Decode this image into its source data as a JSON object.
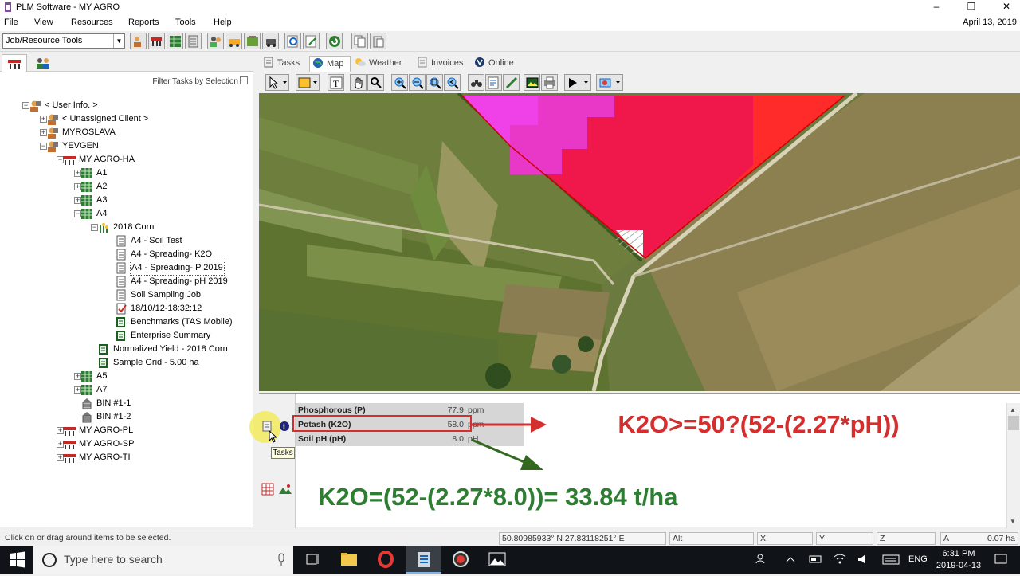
{
  "window": {
    "title": "PLM Software - MY AGRO",
    "controls": [
      "minimize",
      "restore",
      "close"
    ]
  },
  "menubar": {
    "items": [
      "File",
      "View",
      "Resources",
      "Reports",
      "Tools",
      "Help"
    ],
    "date": "April 13, 2019"
  },
  "toolbar": {
    "combo_value": "Job/Resource Tools"
  },
  "left_panel": {
    "filter_label": "Filter Tasks by Selection",
    "tree": [
      {
        "label": "< User Info. >",
        "icon": "user-icon"
      },
      {
        "label": "< Unassigned Client >",
        "icon": "user-icon"
      },
      {
        "label": "MYROSLAVA",
        "icon": "user-icon"
      },
      {
        "label": "YEVGEN",
        "icon": "user-icon"
      },
      {
        "label": "MY AGRO-HA",
        "icon": "farm-icon"
      },
      {
        "label": "A1",
        "icon": "field-icon"
      },
      {
        "label": "A2",
        "icon": "field-icon"
      },
      {
        "label": "A3",
        "icon": "field-icon"
      },
      {
        "label": "A4",
        "icon": "field-icon"
      },
      {
        "label": "2018 Corn",
        "icon": "crop-icon"
      },
      {
        "label": "A4 - Soil Test",
        "icon": "clipboard-icon"
      },
      {
        "label": "A4 - Spreading- K2O",
        "icon": "clipboard-icon"
      },
      {
        "label": "A4 - Spreading- P 2019",
        "icon": "clipboard-icon"
      },
      {
        "label": "A4 - Spreading- pH 2019",
        "icon": "clipboard-icon"
      },
      {
        "label": "Soil Sampling Job",
        "icon": "clipboard-icon"
      },
      {
        "label": "18/10/12-18:32:12",
        "icon": "checked-clipboard-icon"
      },
      {
        "label": "Benchmarks (TAS Mobile)",
        "icon": "report-icon"
      },
      {
        "label": "Enterprise Summary",
        "icon": "report-icon"
      },
      {
        "label": "Normalized Yield - 2018 Corn",
        "icon": "report-icon"
      },
      {
        "label": "Sample Grid - 5.00 ha",
        "icon": "report-icon"
      },
      {
        "label": "A5",
        "icon": "field-icon"
      },
      {
        "label": "A7",
        "icon": "field-icon"
      },
      {
        "label": "BIN #1-1",
        "icon": "bin-icon"
      },
      {
        "label": "BIN #1-2",
        "icon": "bin-icon"
      },
      {
        "label": "MY AGRO-PL",
        "icon": "farm-icon"
      },
      {
        "label": "MY AGRO-SP",
        "icon": "farm-icon"
      },
      {
        "label": "MY AGRO-TI",
        "icon": "farm-icon"
      }
    ]
  },
  "tabs": [
    {
      "label": "Tasks",
      "icon": "tasks-icon"
    },
    {
      "label": "Map",
      "icon": "globe-icon"
    },
    {
      "label": "Weather",
      "icon": "weather-icon"
    },
    {
      "label": "Invoices",
      "icon": "invoice-icon"
    },
    {
      "label": "Online",
      "icon": "online-icon"
    }
  ],
  "info": {
    "rows": [
      {
        "name": "Phosphorous (P)",
        "value": "77.9",
        "unit": "ppm"
      },
      {
        "name": "Potash (K2O)",
        "value": "58.0",
        "unit": "ppm"
      },
      {
        "name": "Soil pH (pH)",
        "value": "8.0",
        "unit": "pH"
      }
    ],
    "tooltip": "Tasks"
  },
  "annotations": {
    "formula_rule": "K2O>=50?(52-(2.27*pH))",
    "formula_result": "K2O=(52-(2.27*8.0))= 33.84 t/ha",
    "colors": {
      "rule": "#d32f2f",
      "result": "#2e7d32"
    }
  },
  "statusbar": {
    "message": "Click on or drag around items to be selected.",
    "coords": "50.80985933° N  27.83118251° E",
    "alt_label": "Alt",
    "x_label": "X",
    "y_label": "Y",
    "z_label": "Z",
    "a_label": "A",
    "area": "0.07 ha"
  },
  "taskbar": {
    "search_placeholder": "Type here to search",
    "language": "ENG",
    "time": "6:31 PM",
    "date": "2019-04-13"
  }
}
